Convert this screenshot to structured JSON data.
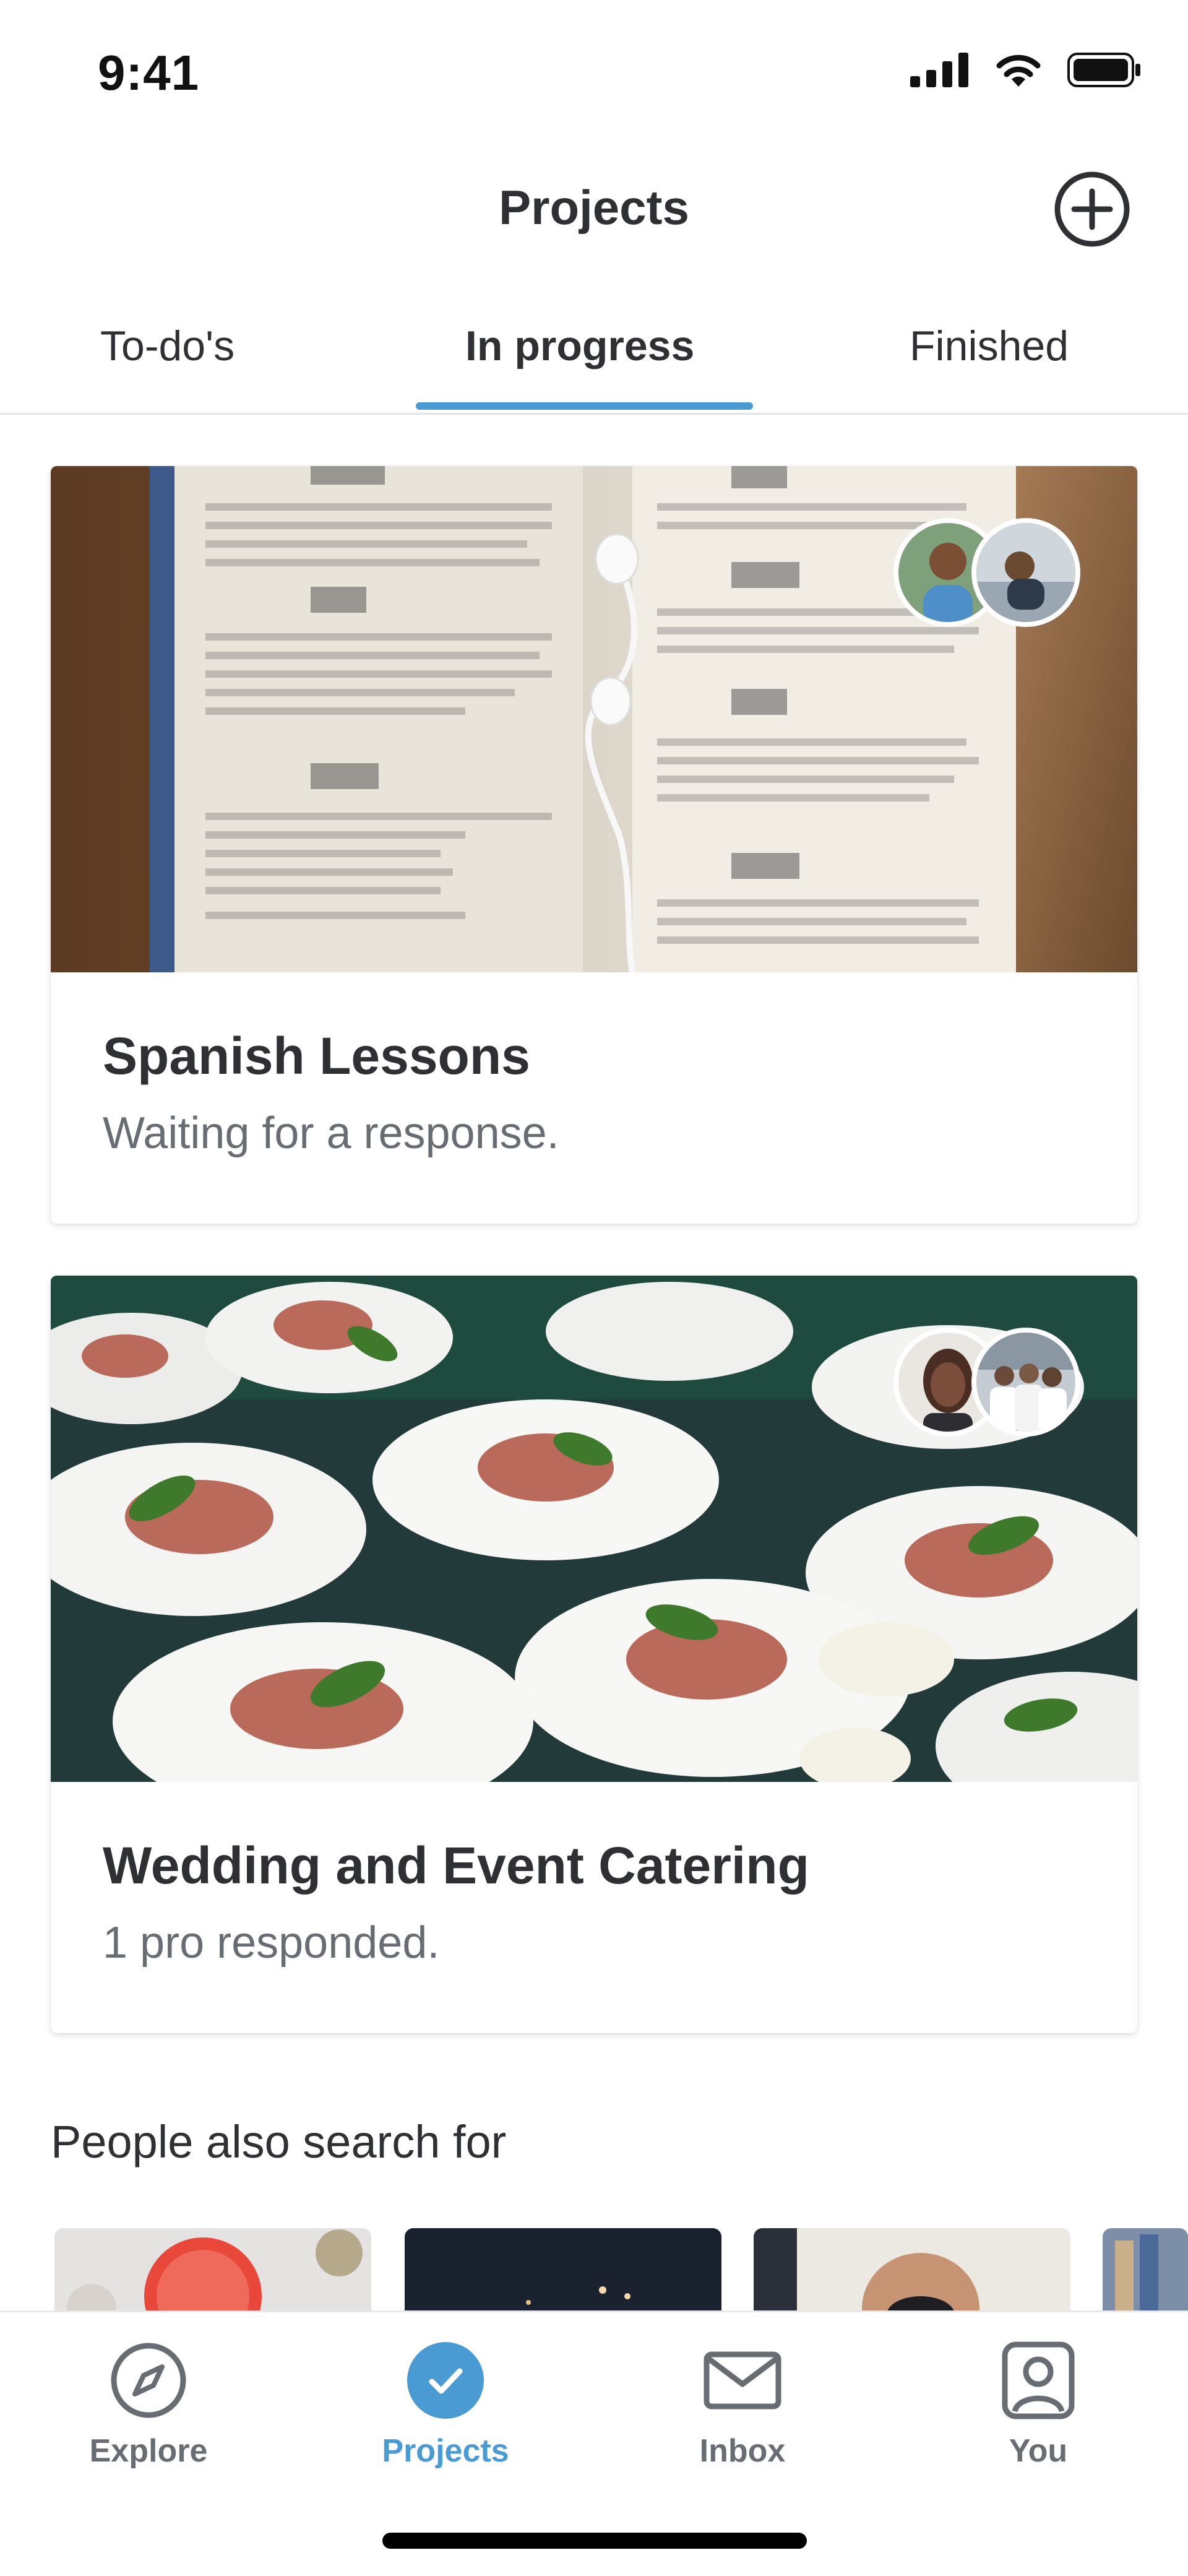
{
  "status_bar": {
    "time": "9:41"
  },
  "header": {
    "title": "Projects",
    "add_icon": "plus-circle-icon"
  },
  "tabs": [
    {
      "label": "To-do's",
      "active": false
    },
    {
      "label": "In progress",
      "active": true
    },
    {
      "label": "Finished",
      "active": false
    }
  ],
  "projects": [
    {
      "title": "Spanish Lessons",
      "status": "Waiting for a response.",
      "image": "open book with earphones"
    },
    {
      "title": "Wedding and Event Catering",
      "status": "1 pro responded.",
      "image": "plated appetizers"
    }
  ],
  "suggestions": {
    "title": "People also search for"
  },
  "bottom_nav": [
    {
      "label": "Explore",
      "icon": "compass-icon",
      "active": false
    },
    {
      "label": "Projects",
      "icon": "check-circle-icon",
      "active": true
    },
    {
      "label": "Inbox",
      "icon": "envelope-icon",
      "active": false
    },
    {
      "label": "You",
      "icon": "user-icon",
      "active": false
    }
  ],
  "colors": {
    "accent": "#4a9ad4",
    "text": "#2f3033",
    "muted": "#676d73"
  }
}
